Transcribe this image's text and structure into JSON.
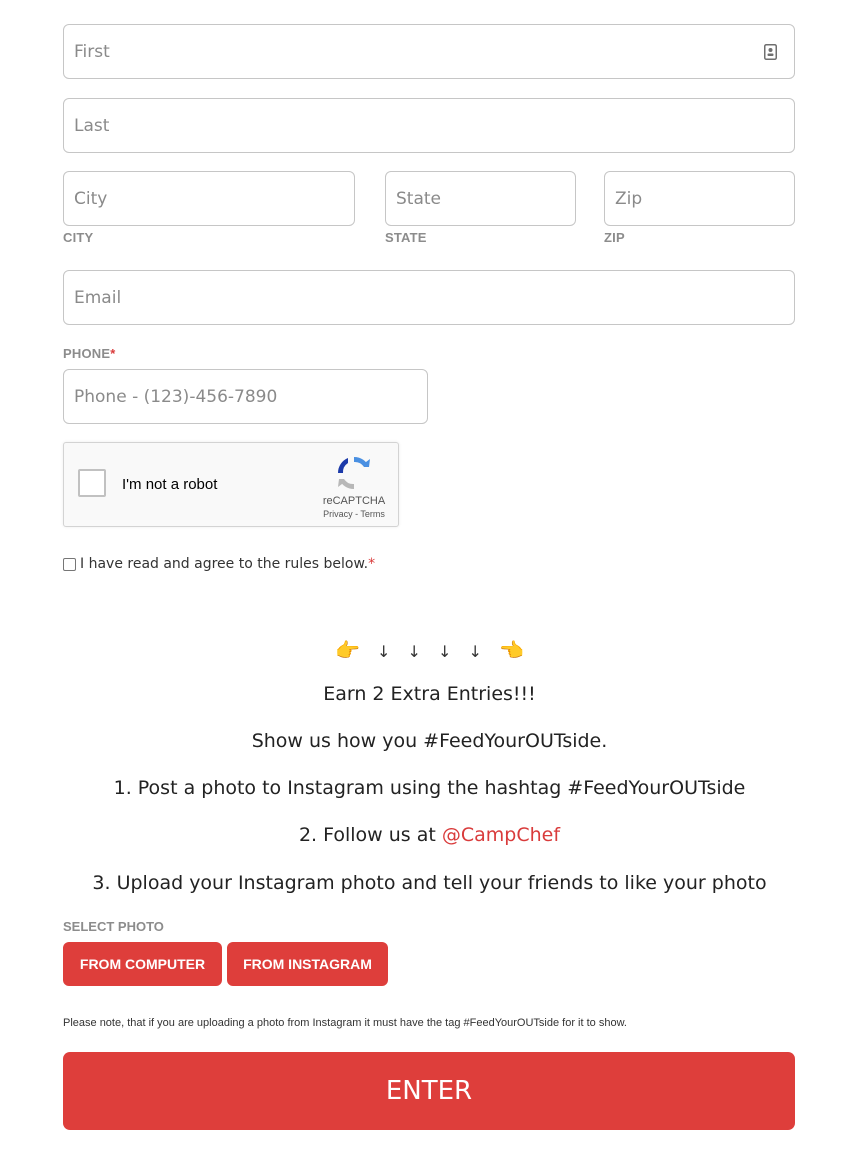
{
  "form": {
    "first": {
      "placeholder": "First",
      "value": ""
    },
    "last": {
      "placeholder": "Last",
      "value": ""
    },
    "city": {
      "placeholder": "City",
      "label": "CITY",
      "value": ""
    },
    "state": {
      "placeholder": "State",
      "label": "STATE",
      "value": ""
    },
    "zip": {
      "placeholder": "Zip",
      "label": "ZIP",
      "value": ""
    },
    "email": {
      "placeholder": "Email",
      "value": ""
    },
    "phone": {
      "label": "PHONE",
      "required_mark": "*",
      "placeholder": "Phone - (123)-456-7890",
      "value": ""
    }
  },
  "recaptcha": {
    "label": "I'm not a robot",
    "brand": "reCAPTCHA",
    "links": "Privacy - Terms"
  },
  "agree": {
    "text": "I have read and agree to the rules below.",
    "required_mark": "*"
  },
  "promo": {
    "pointer_left": "👉",
    "arrows": [
      "↓",
      "↓",
      "↓",
      "↓"
    ],
    "pointer_right": "👈",
    "headline": "Earn 2 Extra Entries!!!",
    "subline": "Show us how you #FeedYourOUTside.",
    "step1": "1. Post a photo to Instagram using the hashtag #FeedYourOUTside",
    "step2_prefix": "2. Follow us at ",
    "step2_link": "@CampChef",
    "step3": "3. Upload your Instagram photo and tell your friends to like your photo"
  },
  "upload": {
    "label": "SELECT PHOTO",
    "from_computer": "FROM COMPUTER",
    "from_instagram": "FROM INSTAGRAM",
    "note": "Please note, that if you are uploading a photo from Instagram it must have the tag #FeedYourOUTside for it to show."
  },
  "submit": {
    "label": "ENTER"
  },
  "colors": {
    "accent": "#de3e3b",
    "label_gray": "#8c8c8c",
    "border": "#c6c6c6"
  }
}
